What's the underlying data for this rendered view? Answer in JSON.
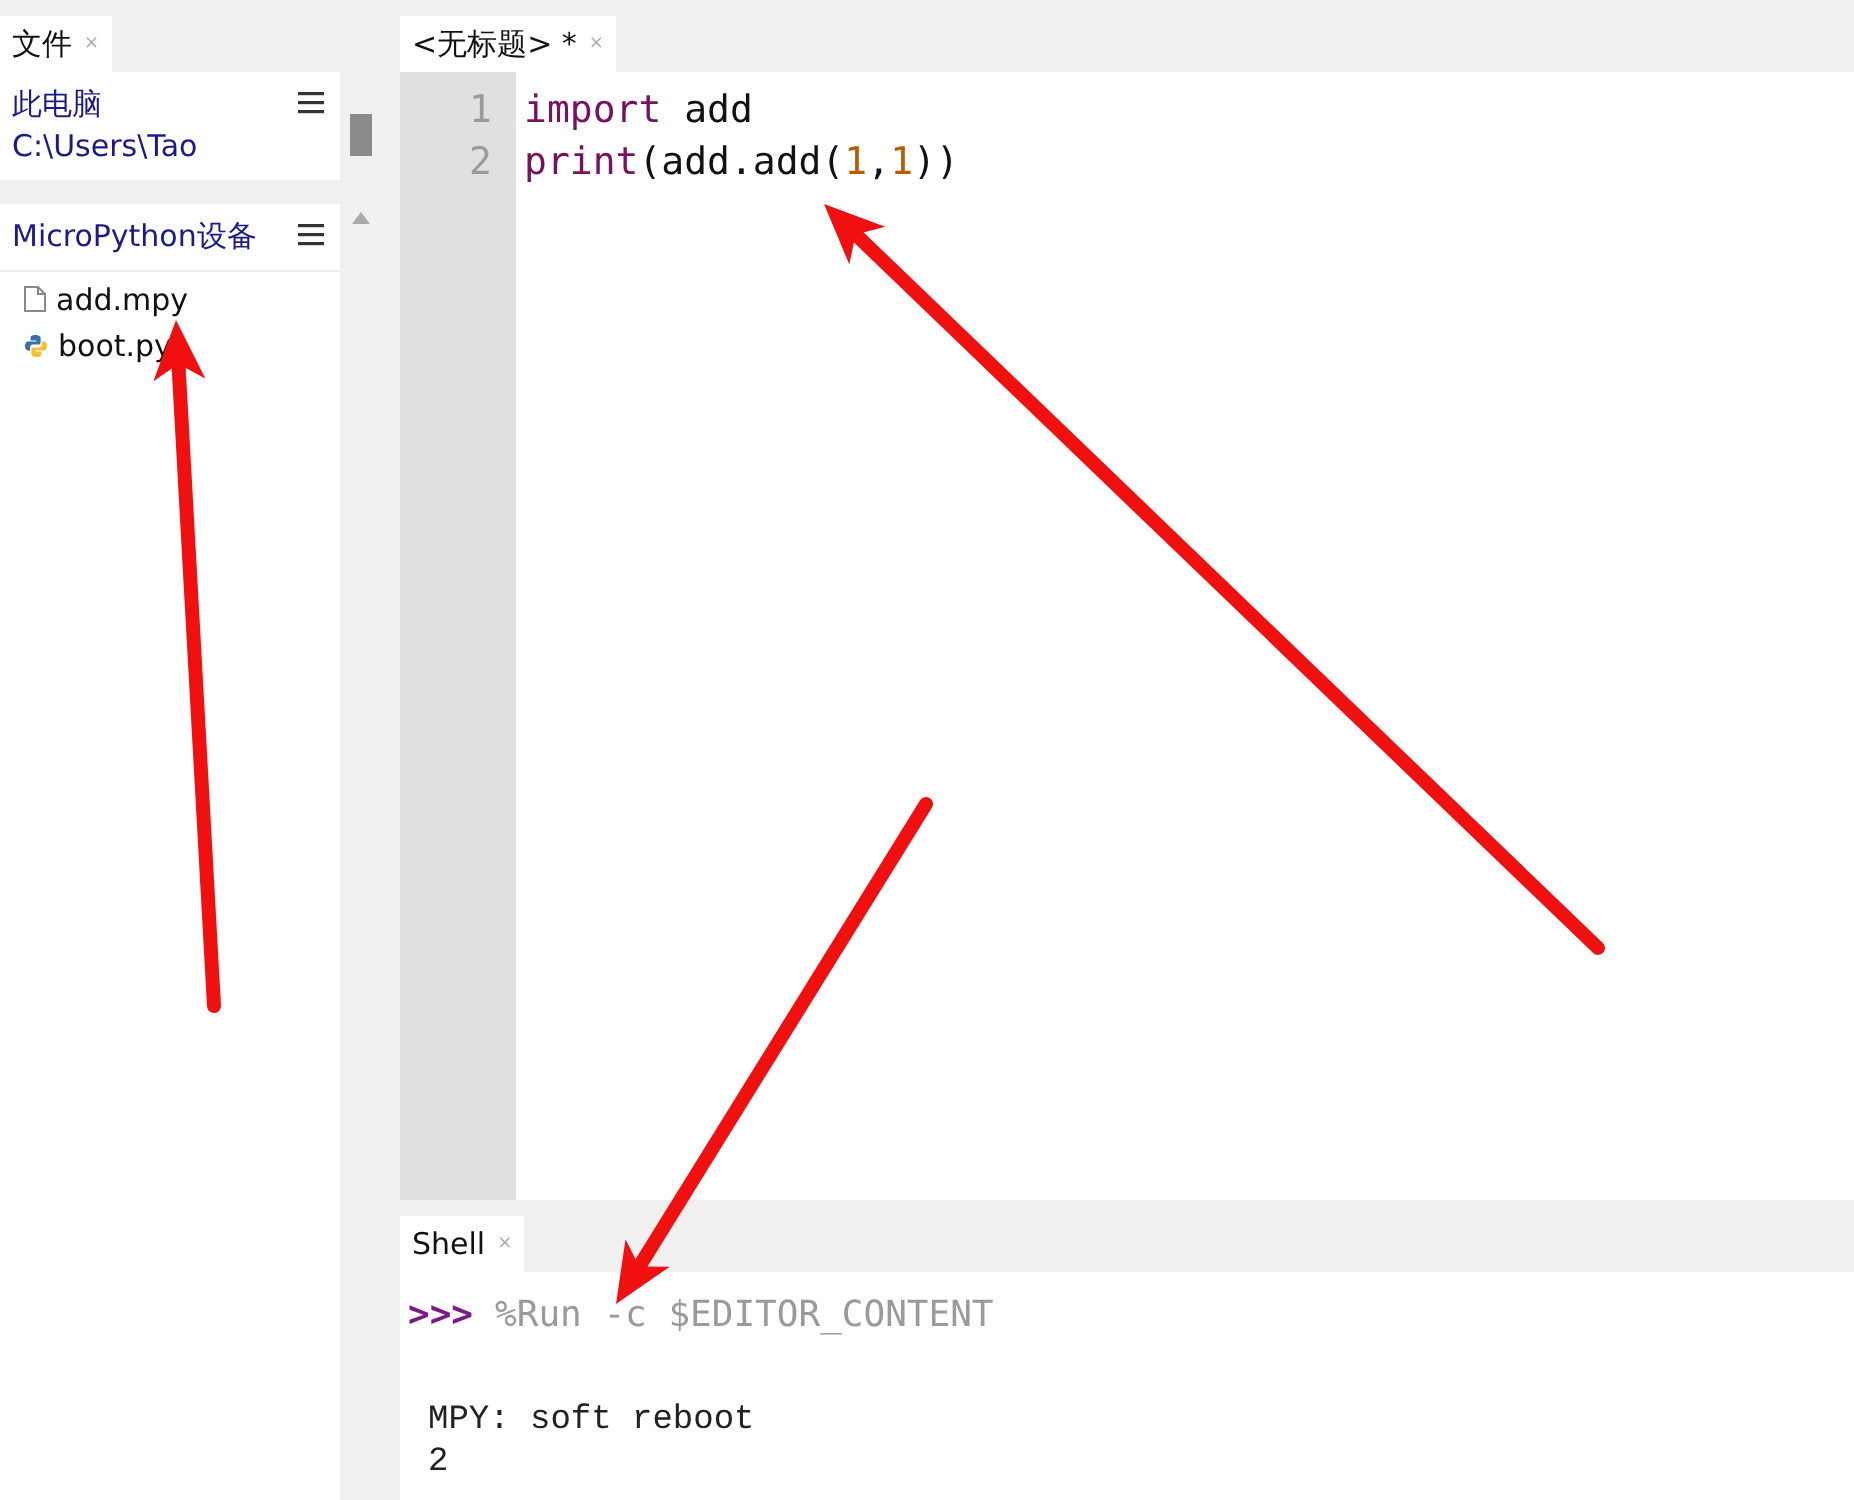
{
  "files_panel": {
    "tab": {
      "label": "文件",
      "close": "×"
    },
    "this_computer": {
      "title": "此电脑",
      "path": "C:\\Users\\Tao"
    },
    "device": {
      "title": "MicroPython设备",
      "items": [
        {
          "name": "add.mpy",
          "kind": "file"
        },
        {
          "name": "boot.py",
          "kind": "python"
        }
      ]
    }
  },
  "editor": {
    "tab": {
      "label": "<无标题> *",
      "close": "×"
    },
    "lines": [
      {
        "number": "1",
        "tokens": [
          {
            "text": "import",
            "kind": "keyword"
          },
          {
            "text": " add",
            "kind": "plain"
          }
        ]
      },
      {
        "number": "2",
        "tokens": [
          {
            "text": "print",
            "kind": "keyword"
          },
          {
            "text": "(add.add(",
            "kind": "plain"
          },
          {
            "text": "1",
            "kind": "number"
          },
          {
            "text": ",",
            "kind": "plain"
          },
          {
            "text": "1",
            "kind": "number"
          },
          {
            "text": "))",
            "kind": "plain"
          }
        ]
      }
    ]
  },
  "shell": {
    "tab": {
      "label": "Shell",
      "close": "×"
    },
    "prompt": ">>>",
    "command": "%Run -c $EDITOR_CONTENT",
    "output": [
      "MPY: soft reboot",
      "2"
    ]
  }
}
